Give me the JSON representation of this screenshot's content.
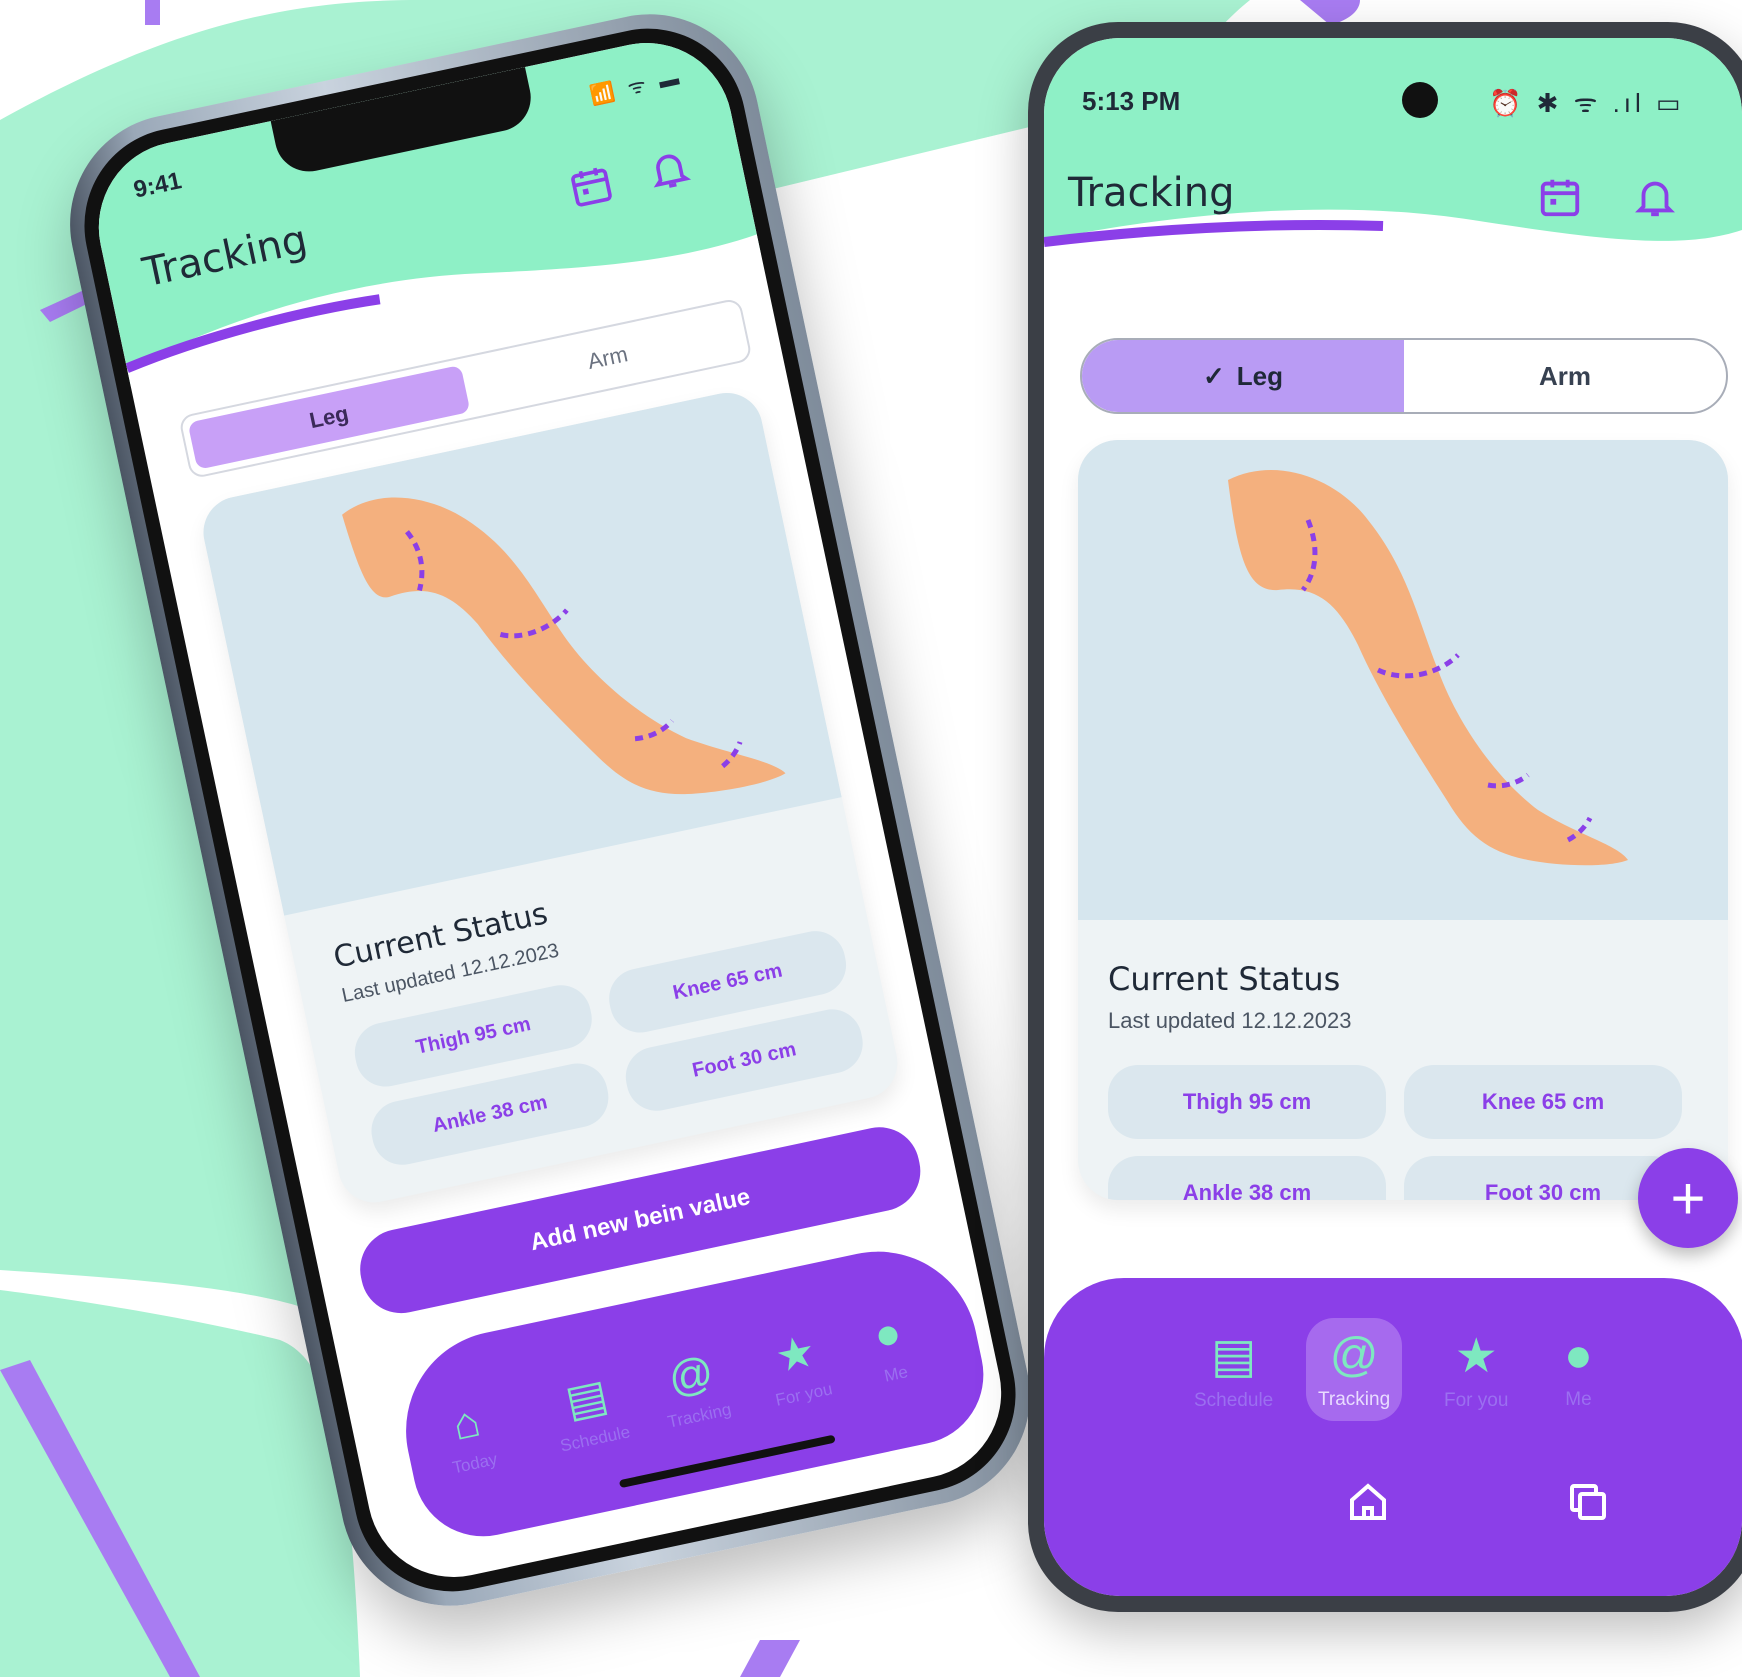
{
  "brand": {
    "mint": "#8ef0c6",
    "purple": "#8b3fe8",
    "lavender": "#c8a0f7",
    "card_bg": "#d6e6ee"
  },
  "iphone": {
    "status": {
      "time": "9:41",
      "icons": "📶 ᯤ ▬"
    },
    "title": "Tracking",
    "header_icons": [
      "calendar-icon",
      "bell-icon"
    ],
    "tabs": [
      {
        "label": "Leg",
        "active": true
      },
      {
        "label": "Arm",
        "active": false
      }
    ],
    "status_card": {
      "title": "Current Status",
      "subtitle": "Last updated 12.12.2023",
      "chips": [
        "Thigh 95 cm",
        "Knee 65 cm",
        "Ankle 38 cm",
        "Foot 30 cm"
      ]
    },
    "primary_button": "Add new bein value",
    "nav": [
      {
        "label": "Today",
        "icon": "home-icon"
      },
      {
        "label": "Schedule",
        "icon": "schedule-icon"
      },
      {
        "label": "Tracking",
        "icon": "tape-measure-icon"
      },
      {
        "label": "For you",
        "icon": "star-icon"
      },
      {
        "label": "Me",
        "icon": "profile-icon"
      }
    ]
  },
  "android": {
    "status": {
      "time": "5:13 PM",
      "icons": "⏰ ✱ ᯤ .ıl ▭"
    },
    "title": "Tracking",
    "header_icons": [
      "calendar-icon",
      "bell-icon"
    ],
    "tabs": [
      {
        "label": "Leg",
        "check": "✓",
        "active": true
      },
      {
        "label": "Arm",
        "active": false
      }
    ],
    "status_card": {
      "title": "Current Status",
      "subtitle": "Last updated 12.12.2023",
      "chips": [
        "Thigh 95 cm",
        "Knee 65 cm",
        "Ankle 38 cm",
        "Foot 30 cm"
      ]
    },
    "fab": "+",
    "nav": [
      {
        "label": "Schedule",
        "icon": "schedule-icon"
      },
      {
        "label": "Tracking",
        "icon": "tape-measure-icon",
        "active": true
      },
      {
        "label": "For you",
        "icon": "star-icon"
      },
      {
        "label": "Me",
        "icon": "profile-icon"
      }
    ],
    "system_nav": [
      "home-button-icon",
      "recents-icon"
    ]
  }
}
